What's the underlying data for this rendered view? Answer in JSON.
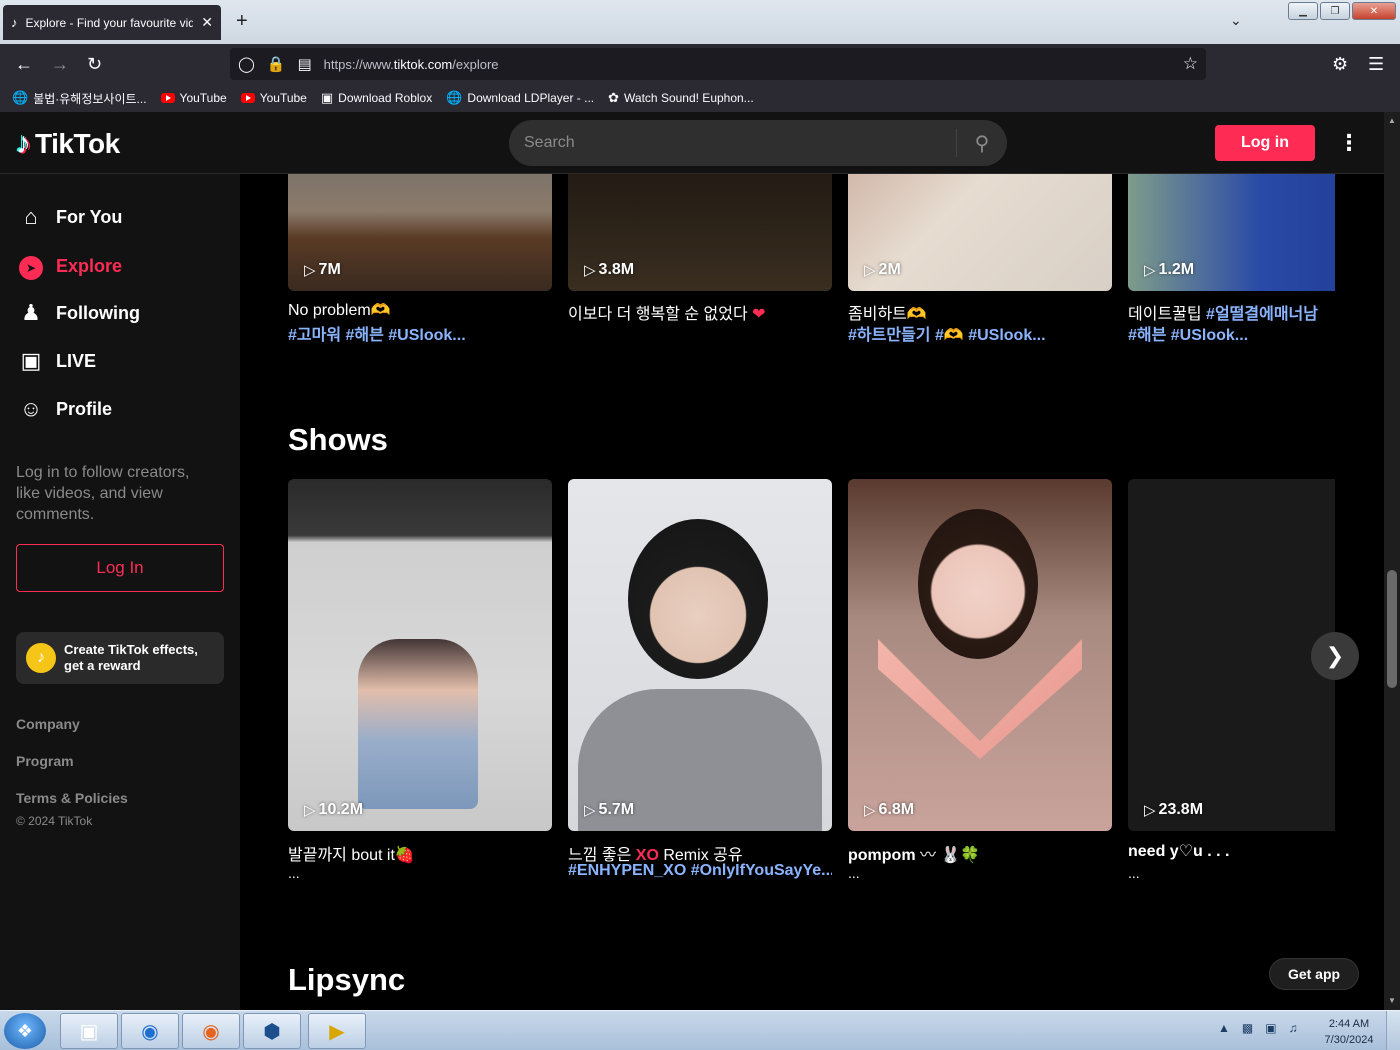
{
  "browser": {
    "tab_title": "Explore - Find your favourite videos on TikTok",
    "new_tab": "+",
    "tab_close": "✕",
    "url_prefix": "https://www.",
    "url_domain": "tiktok.com",
    "url_path": "/explore",
    "window_buttons": [
      "▁",
      "❐",
      "✕"
    ]
  },
  "bookmarks": [
    {
      "label": "불법·유해정보사이트...",
      "icon": "globe-icon"
    },
    {
      "label": "YouTube",
      "icon": "youtube-icon"
    },
    {
      "label": "YouTube",
      "icon": "youtube-icon"
    },
    {
      "label": "Download Roblox",
      "icon": "roblox-icon"
    },
    {
      "label": "Download LDPlayer - ...",
      "icon": "globe-icon"
    },
    {
      "label": "Watch Sound! Euphon...",
      "icon": "site-icon"
    }
  ],
  "header": {
    "logo_text": "TikTok",
    "search_placeholder": "Search",
    "login_label": "Log in"
  },
  "sidebar": {
    "nav": [
      {
        "label": "For You",
        "icon": "home-icon",
        "active": false
      },
      {
        "label": "Explore",
        "icon": "compass-icon",
        "active": true
      },
      {
        "label": "Following",
        "icon": "users-icon",
        "active": false
      },
      {
        "label": "LIVE",
        "icon": "live-icon",
        "active": false
      },
      {
        "label": "Profile",
        "icon": "person-icon",
        "active": false
      }
    ],
    "login_note": "Log in to follow creators, like videos, and view comments.",
    "login_button": "Log In",
    "effects_line1": "Create TikTok effects,",
    "effects_line2": "get a reward",
    "footer_links": [
      "Company",
      "Program",
      "Terms & Policies"
    ],
    "copyright": "© 2024 TikTok"
  },
  "sections": {
    "top_row": [
      {
        "views": "7M",
        "title": "No problem🫶",
        "tags": "#고마워 #해븐 #USlook..."
      },
      {
        "views": "3.8M",
        "title": "이보다 더 행복할 순 없었다",
        "heart": "❤",
        "tags": ""
      },
      {
        "views": "2M",
        "title": "좀비하트🫶",
        "tags": "#하트만들기 #🫶 #USlook..."
      },
      {
        "views": "1.2M",
        "title": "데이트꿀팁 ",
        "title_tags": "#얼떨결에매너남",
        "tags": "#해븐 #USlook..."
      }
    ],
    "shows_title": "Shows",
    "shows": [
      {
        "views": "10.2M",
        "title": "발끝까지 bout it🍓",
        "tags": "",
        "extra": "..."
      },
      {
        "views": "5.7M",
        "title_pre": "느낌 좋은 ",
        "title_xo": "XO",
        "title_post": " Remix 공유",
        "tags": "#ENHYPEN_XO #OnlyIfYouSayYe...",
        "extra": ""
      },
      {
        "views": "6.8M",
        "title": "pompom ",
        "emoji": "〰 🐰🍀",
        "tags": "",
        "extra": "..."
      },
      {
        "views": "23.8M",
        "title": "need y♡u . . .",
        "tags": "",
        "extra": "..."
      }
    ],
    "lipsync_title": "Lipsync",
    "get_app": "Get app"
  },
  "taskbar": {
    "time": "2:44 AM",
    "date": "7/30/2024"
  }
}
